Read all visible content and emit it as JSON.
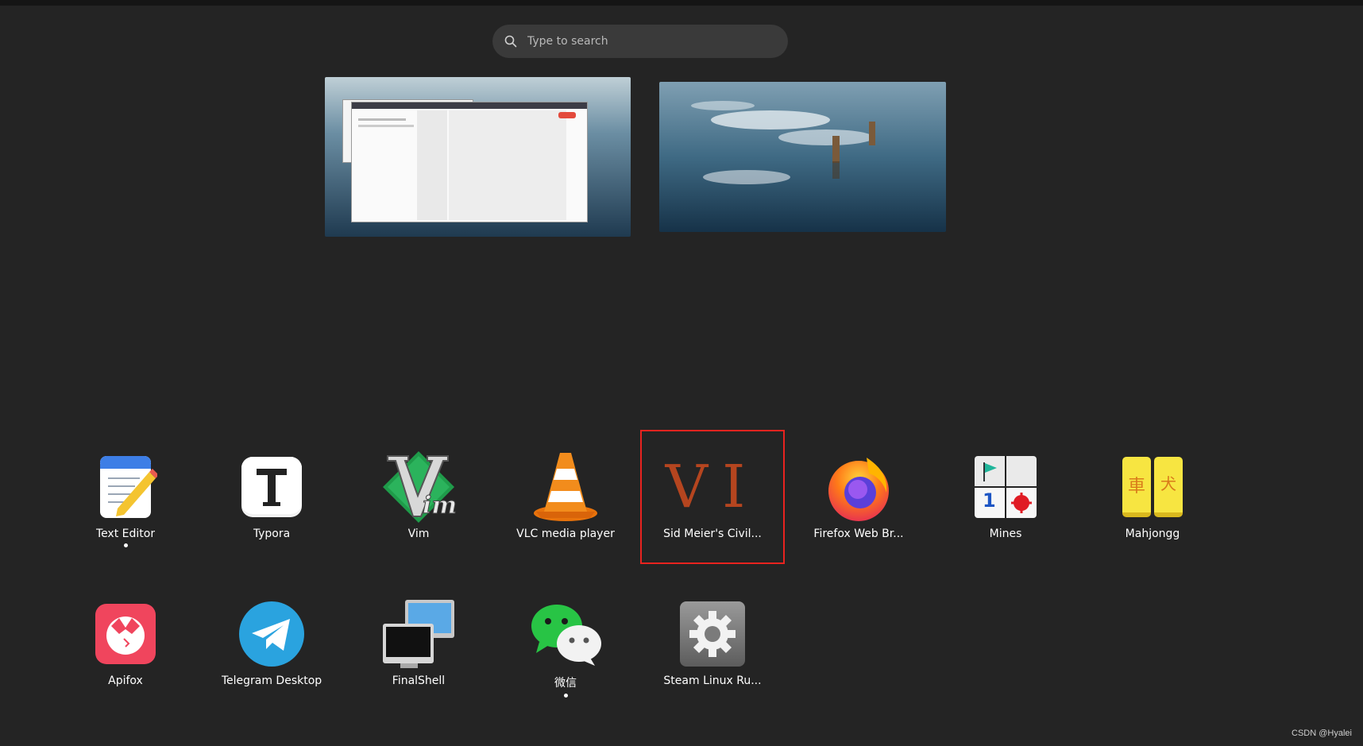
{
  "search": {
    "placeholder": "Type to search"
  },
  "apps": [
    {
      "label": "Text Editor",
      "icon": "text-editor-icon",
      "running": true
    },
    {
      "label": "Typora",
      "icon": "typora-icon",
      "running": false
    },
    {
      "label": "Vim",
      "icon": "vim-icon",
      "running": false
    },
    {
      "label": "VLC media player",
      "icon": "vlc-icon",
      "running": false
    },
    {
      "label": "Sid Meier's Civil...",
      "icon": "civilization-vi-icon",
      "icon_text": "VI",
      "running": false,
      "selected": true
    },
    {
      "label": "Firefox Web Br...",
      "icon": "firefox-icon",
      "running": false
    },
    {
      "label": "Mines",
      "icon": "mines-icon",
      "icon_text": "1",
      "running": false
    },
    {
      "label": "Mahjongg",
      "icon": "mahjongg-icon",
      "icon_text": [
        "車",
        "犬"
      ],
      "running": false
    },
    {
      "label": "Apifox",
      "icon": "apifox-icon",
      "running": false
    },
    {
      "label": "Telegram Desktop",
      "icon": "telegram-icon",
      "running": false
    },
    {
      "label": "FinalShell",
      "icon": "finalshell-icon",
      "running": false
    },
    {
      "label": "微信",
      "icon": "wechat-icon",
      "running": true
    },
    {
      "label": "Steam Linux Ru...",
      "icon": "steam-linux-runtime-icon",
      "running": false
    }
  ],
  "watermark": "CSDN @Hyalei",
  "colors": {
    "background": "#242424",
    "selection_border": "#e8231f"
  }
}
